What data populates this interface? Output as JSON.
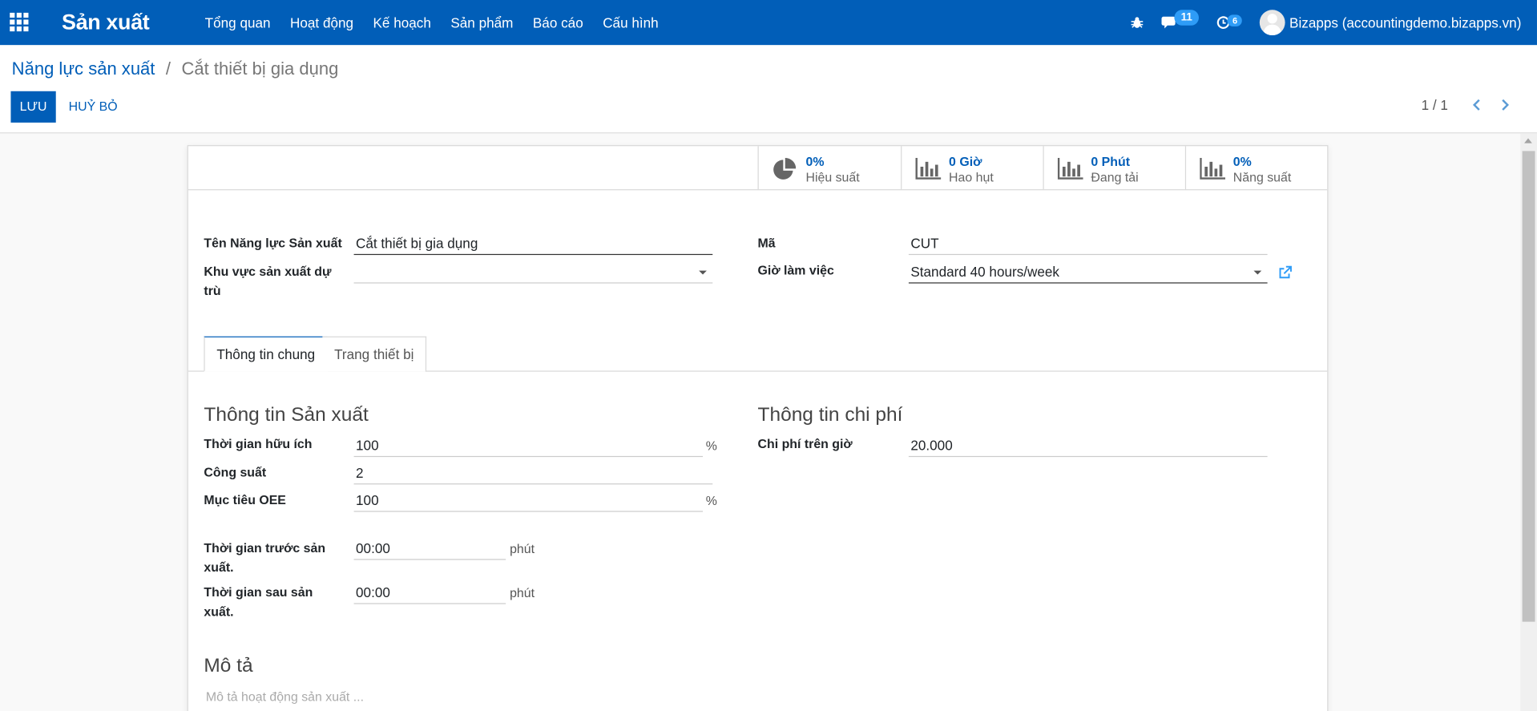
{
  "app": {
    "title": "Sản xuất"
  },
  "menu": [
    {
      "label": "Tổng quan"
    },
    {
      "label": "Hoạt động"
    },
    {
      "label": "Kế hoạch"
    },
    {
      "label": "Sản phẩm"
    },
    {
      "label": "Báo cáo"
    },
    {
      "label": "Cấu hình"
    }
  ],
  "systray": {
    "messages_count": "11",
    "activities_count": "6",
    "user": "Bizapps (accountingdemo.bizapps.vn)"
  },
  "breadcrumb": {
    "parent": "Năng lực sản xuất",
    "separator": "/",
    "current": "Cắt thiết bị gia dụng"
  },
  "buttons": {
    "save": "LƯU",
    "discard": "HUỶ BỎ"
  },
  "pager": {
    "value": "1 / 1"
  },
  "stats": [
    {
      "value": "0%",
      "label": "Hiệu suất",
      "icon": "pie-chart-icon"
    },
    {
      "value": "0 Giờ",
      "label": "Hao hụt",
      "icon": "bar-chart-icon"
    },
    {
      "value": "0 Phút",
      "label": "Đang tải",
      "icon": "bar-chart-icon"
    },
    {
      "value": "0%",
      "label": "Năng suất",
      "icon": "bar-chart-icon"
    }
  ],
  "form": {
    "name_label": "Tên Năng lực Sản xuất",
    "name_value": "Cắt thiết bị gia dụng",
    "alt_label_1": "Khu vực sản xuất dự",
    "alt_label_2": "trù",
    "alt_value": "",
    "code_label": "Mã",
    "code_value": "CUT",
    "hours_label": "Giờ làm việc",
    "hours_value": "Standard 40 hours/week"
  },
  "tabs": [
    {
      "label": "Thông tin chung"
    },
    {
      "label": "Trang thiết bị"
    }
  ],
  "production": {
    "title": "Thông tin Sản xuất",
    "efficiency_label": "Thời gian hữu ích",
    "efficiency_value": "100",
    "efficiency_unit": "%",
    "capacity_label": "Công suất",
    "capacity_value": "2",
    "oee_label": "Mục tiêu OEE",
    "oee_value": "100",
    "oee_unit": "%",
    "time_start_label_1": "Thời gian trước sản",
    "time_start_label_2": "xuất.",
    "time_start_value": "00:00",
    "time_start_unit": "phút",
    "time_stop_label_1": "Thời gian sau sản",
    "time_stop_label_2": "xuất.",
    "time_stop_value": "00:00",
    "time_stop_unit": "phút"
  },
  "costing": {
    "title": "Thông tin chi phí",
    "cost_label": "Chi phí trên giờ",
    "cost_value": "20.000"
  },
  "description": {
    "title": "Mô tả",
    "placeholder": "Mô tả hoạt động sản xuất ..."
  },
  "colors": {
    "primary": "#015eb8",
    "badge": "#2e9cf7"
  }
}
